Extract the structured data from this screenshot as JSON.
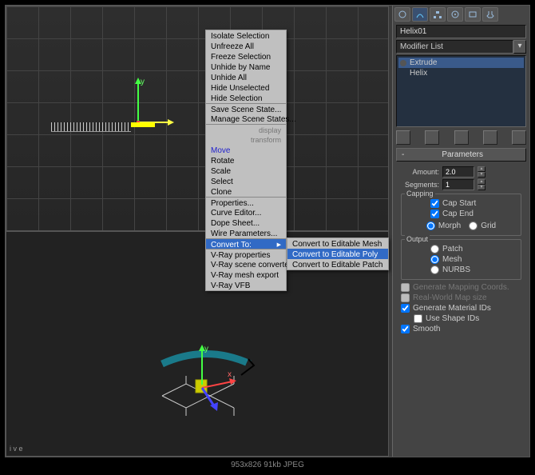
{
  "selection_name": "Helix01",
  "modifier_list_label": "Modifier List",
  "stack": {
    "mods": [
      "Extrude",
      "Helix"
    ]
  },
  "context_menu": {
    "items": [
      "Isolate Selection",
      "Unfreeze All",
      "Freeze Selection",
      "Unhide by Name",
      "Unhide All",
      "Hide Unselected",
      "Hide Selection",
      "Save Scene State...",
      "Manage Scene States..."
    ],
    "dim1": "display",
    "dim2": "transform",
    "items2": [
      "Move",
      "Rotate",
      "Scale",
      "Select",
      "Clone"
    ],
    "items3": [
      "Properties...",
      "Curve Editor...",
      "Dope Sheet...",
      "Wire Parameters..."
    ],
    "convert": "Convert To:",
    "items4": [
      "V-Ray properties",
      "V-Ray scene converter",
      "V-Ray mesh export",
      "V-Ray VFB"
    ]
  },
  "submenu": {
    "items": [
      "Convert to Editable Mesh",
      "Convert to Editable Poly",
      "Convert to Editable Patch"
    ]
  },
  "params": {
    "title": "Parameters",
    "amount_label": "Amount:",
    "amount": "2.0",
    "segments_label": "Segments:",
    "segments": "1",
    "capping": "Capping",
    "cap_start": "Cap Start",
    "cap_end": "Cap End",
    "morph": "Morph",
    "grid": "Grid",
    "output": "Output",
    "patch": "Patch",
    "mesh": "Mesh",
    "nurbs": "NURBS",
    "gen_map": "Generate Mapping Coords.",
    "real_world": "Real-World Map size",
    "gen_mat": "Generate Material IDs",
    "use_shape": "Use Shape IDs",
    "smooth": "Smooth"
  },
  "status": "953x826   91kb   JPEG",
  "vp_label": "i v e"
}
